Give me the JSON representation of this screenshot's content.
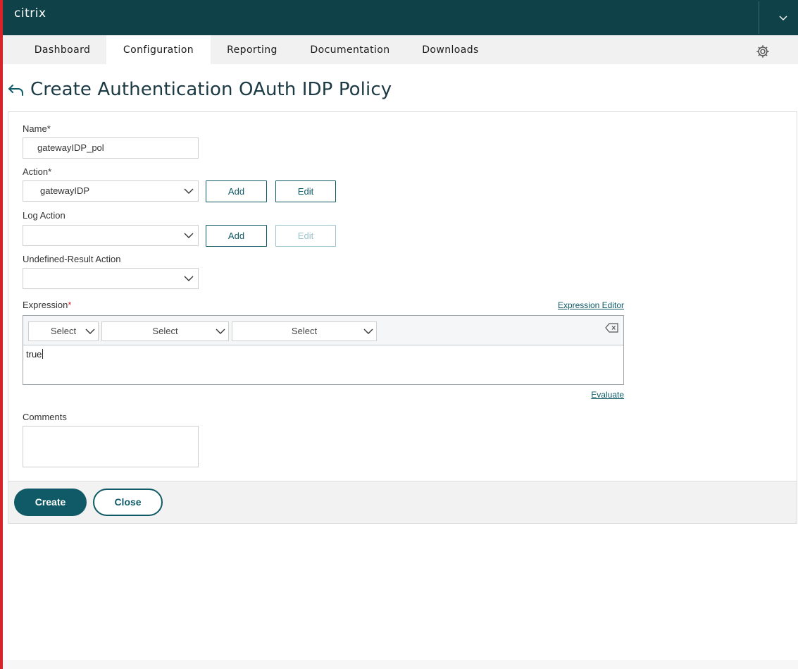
{
  "brand": {
    "logo": "citrix"
  },
  "header": {
    "menu_icon": "chevron-down-icon"
  },
  "tabs": [
    {
      "label": "Dashboard",
      "active": false
    },
    {
      "label": "Configuration",
      "active": true
    },
    {
      "label": "Reporting",
      "active": false
    },
    {
      "label": "Documentation",
      "active": false
    },
    {
      "label": "Downloads",
      "active": false
    }
  ],
  "page": {
    "title": "Create Authentication OAuth IDP Policy"
  },
  "form": {
    "name": {
      "label": "Name",
      "required_mark": "*",
      "value": "gatewayIDP_pol"
    },
    "action": {
      "label": "Action",
      "required_mark": "*",
      "value": "gatewayIDP",
      "add_label": "Add",
      "edit_label": "Edit"
    },
    "log_action": {
      "label": "Log Action",
      "value": "",
      "add_label": "Add",
      "edit_label": "Edit",
      "edit_disabled": true
    },
    "undefined_result_action": {
      "label": "Undefined-Result Action",
      "value": ""
    },
    "expression": {
      "label": "Expression",
      "required_mark": "*",
      "editor_link": "Expression Editor",
      "selects": [
        "Select",
        "Select",
        "Select"
      ],
      "value": "true",
      "evaluate_link": "Evaluate"
    },
    "comments": {
      "label": "Comments",
      "value": ""
    }
  },
  "footer": {
    "create_label": "Create",
    "close_label": "Close"
  },
  "colors": {
    "header_bg": "#0f4149",
    "accent": "#0f5a66",
    "required": "#c52a2a",
    "left_stripe": "#d8232a"
  }
}
